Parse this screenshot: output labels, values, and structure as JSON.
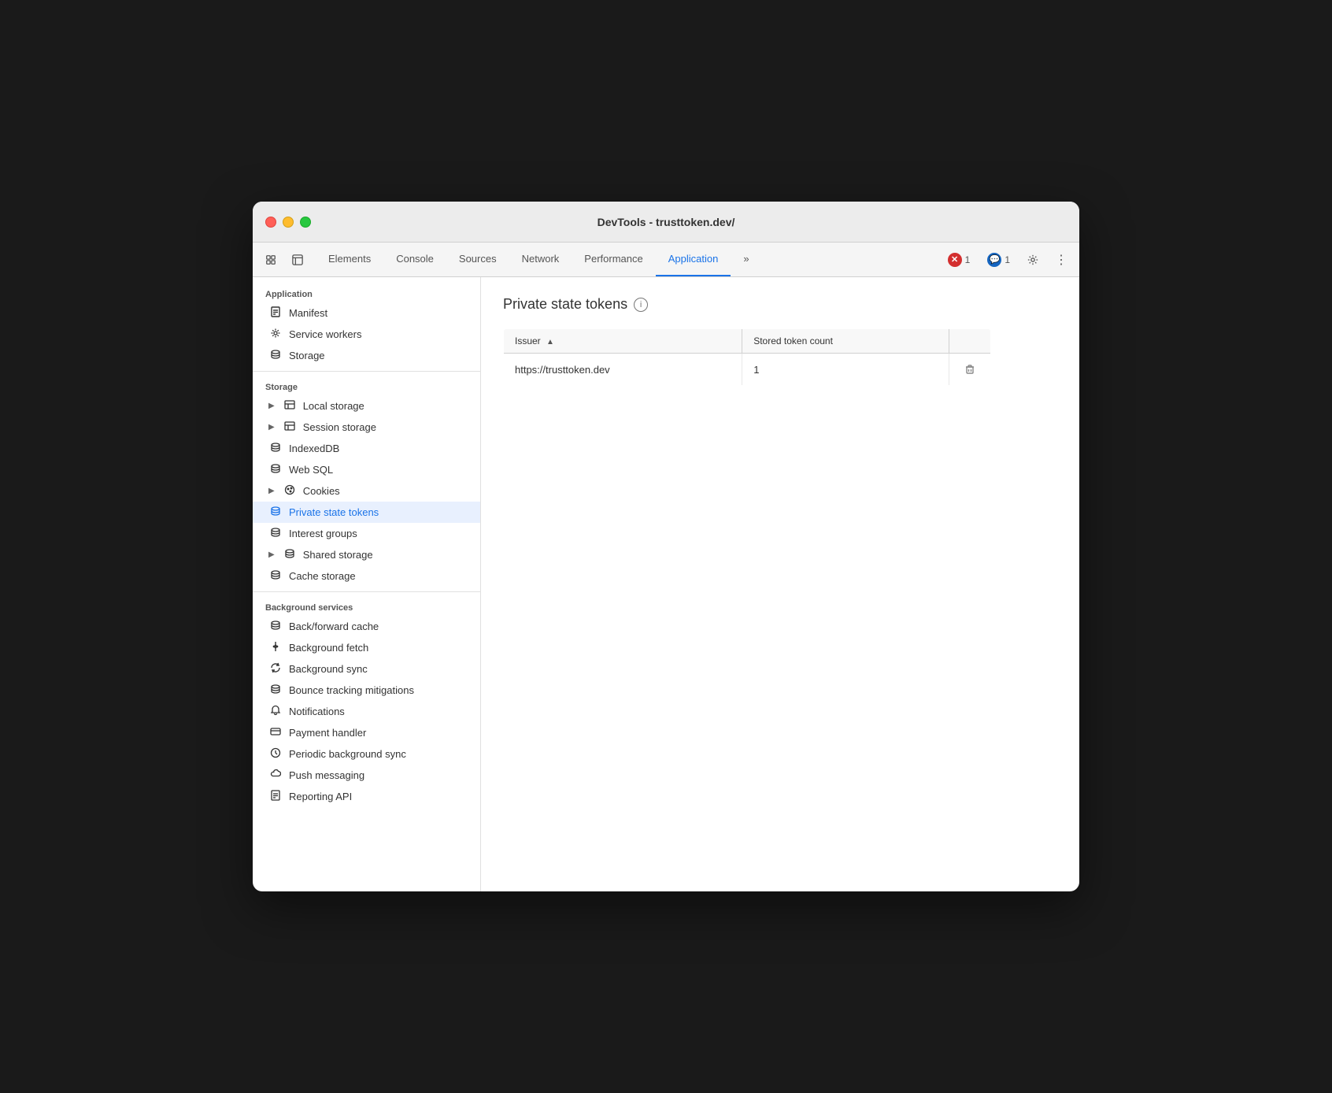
{
  "window": {
    "title": "DevTools - trusttoken.dev/"
  },
  "toolbar": {
    "tabs": [
      {
        "id": "elements",
        "label": "Elements",
        "active": false
      },
      {
        "id": "console",
        "label": "Console",
        "active": false
      },
      {
        "id": "sources",
        "label": "Sources",
        "active": false
      },
      {
        "id": "network",
        "label": "Network",
        "active": false
      },
      {
        "id": "performance",
        "label": "Performance",
        "active": false
      },
      {
        "id": "application",
        "label": "Application",
        "active": true
      },
      {
        "id": "more",
        "label": "»",
        "active": false
      }
    ],
    "error_count": "1",
    "warn_count": "1"
  },
  "sidebar": {
    "application_section": "Application",
    "application_items": [
      {
        "id": "manifest",
        "label": "Manifest",
        "icon": "doc",
        "has_arrow": false
      },
      {
        "id": "service-workers",
        "label": "Service workers",
        "icon": "gear",
        "has_arrow": false
      },
      {
        "id": "storage",
        "label": "Storage",
        "icon": "db",
        "has_arrow": false
      }
    ],
    "storage_section": "Storage",
    "storage_items": [
      {
        "id": "local-storage",
        "label": "Local storage",
        "icon": "table",
        "has_arrow": true
      },
      {
        "id": "session-storage",
        "label": "Session storage",
        "icon": "table",
        "has_arrow": true
      },
      {
        "id": "indexeddb",
        "label": "IndexedDB",
        "icon": "db",
        "has_arrow": false
      },
      {
        "id": "web-sql",
        "label": "Web SQL",
        "icon": "db",
        "has_arrow": false
      },
      {
        "id": "cookies",
        "label": "Cookies",
        "icon": "cookie",
        "has_arrow": true
      },
      {
        "id": "private-state-tokens",
        "label": "Private state tokens",
        "icon": "db",
        "has_arrow": false,
        "active": true
      },
      {
        "id": "interest-groups",
        "label": "Interest groups",
        "icon": "db",
        "has_arrow": false
      },
      {
        "id": "shared-storage",
        "label": "Shared storage",
        "icon": "db",
        "has_arrow": true
      },
      {
        "id": "cache-storage",
        "label": "Cache storage",
        "icon": "db",
        "has_arrow": false
      }
    ],
    "background_section": "Background services",
    "background_items": [
      {
        "id": "back-forward-cache",
        "label": "Back/forward cache",
        "icon": "db",
        "has_arrow": false
      },
      {
        "id": "background-fetch",
        "label": "Background fetch",
        "icon": "fetch",
        "has_arrow": false
      },
      {
        "id": "background-sync",
        "label": "Background sync",
        "icon": "sync",
        "has_arrow": false
      },
      {
        "id": "bounce-tracking",
        "label": "Bounce tracking mitigations",
        "icon": "db",
        "has_arrow": false
      },
      {
        "id": "notifications",
        "label": "Notifications",
        "icon": "bell",
        "has_arrow": false
      },
      {
        "id": "payment-handler",
        "label": "Payment handler",
        "icon": "card",
        "has_arrow": false
      },
      {
        "id": "periodic-background-sync",
        "label": "Periodic background sync",
        "icon": "clock",
        "has_arrow": false
      },
      {
        "id": "push-messaging",
        "label": "Push messaging",
        "icon": "cloud",
        "has_arrow": false
      },
      {
        "id": "reporting-api",
        "label": "Reporting API",
        "icon": "doc",
        "has_arrow": false
      }
    ]
  },
  "content": {
    "title": "Private state tokens",
    "table": {
      "columns": [
        {
          "id": "issuer",
          "label": "Issuer",
          "sortable": true
        },
        {
          "id": "token-count",
          "label": "Stored token count",
          "sortable": false
        },
        {
          "id": "actions",
          "label": "",
          "sortable": false
        }
      ],
      "rows": [
        {
          "issuer": "https://trusttoken.dev",
          "token_count": "1"
        }
      ]
    }
  }
}
